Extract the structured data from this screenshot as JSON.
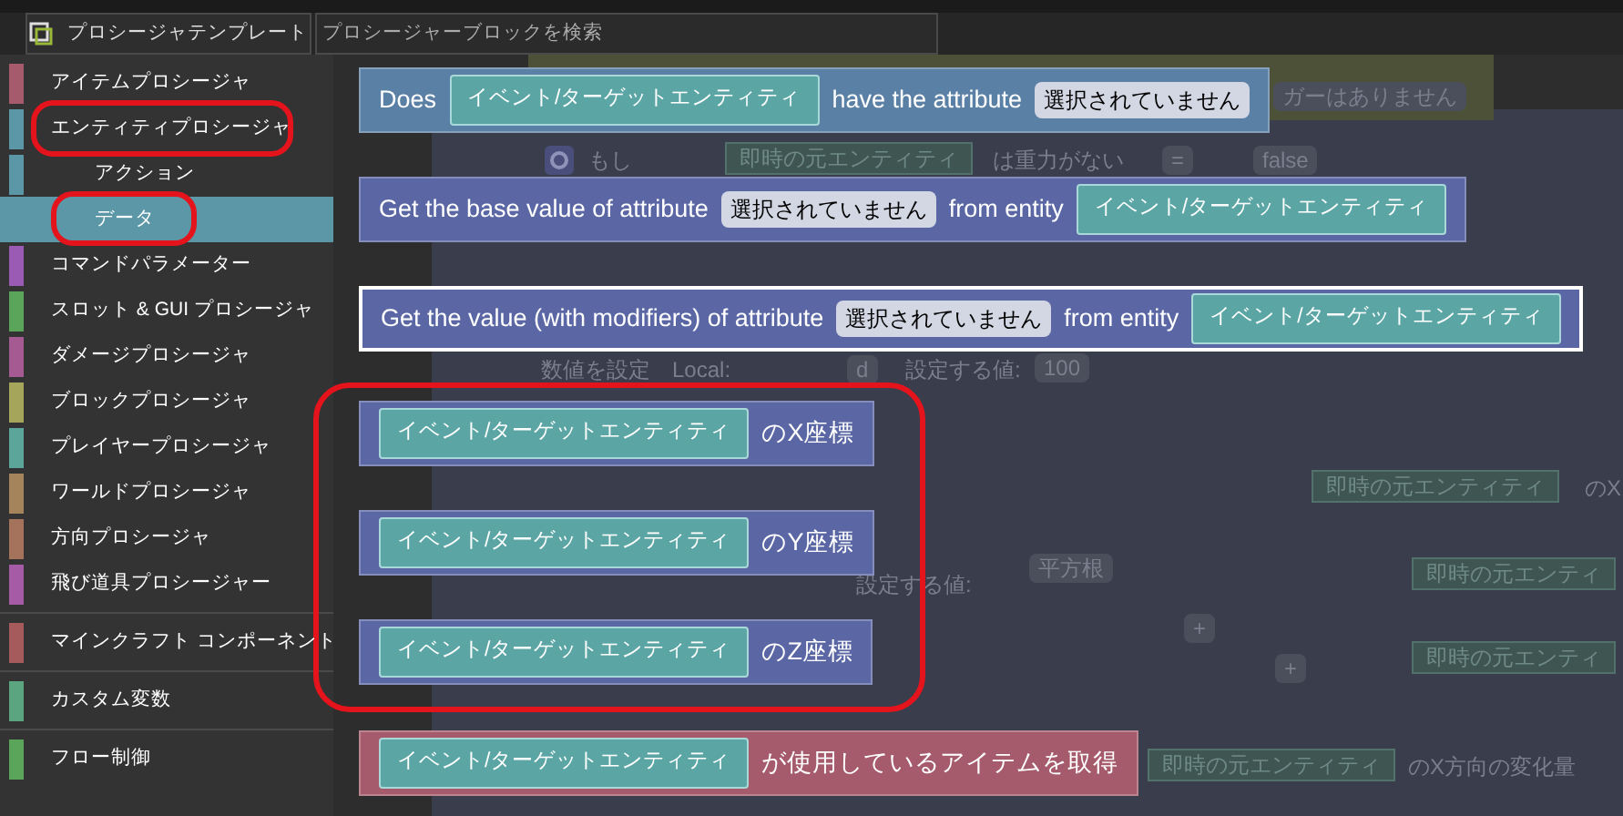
{
  "header": {
    "tab": "プロシージャテンプレート",
    "search": {
      "placeholder": "プロシージャーブロックを検索"
    }
  },
  "sidebar": {
    "groups": [
      [
        {
          "label": "アイテムプロシージャ",
          "kind": "category",
          "color": "#a55b6b",
          "selected": false,
          "circled": false
        },
        {
          "label": "エンティティプロシージャ",
          "kind": "category",
          "color": "#5b97a6",
          "selected": false,
          "circled": true
        },
        {
          "label": "アクション",
          "kind": "subcategory",
          "color": "#5b97a6",
          "selected": false,
          "circled": false
        },
        {
          "label": "データ",
          "kind": "subcategory",
          "color": "#5b97a6",
          "selected": true,
          "circled": true
        },
        {
          "label": "コマンドパラメーター",
          "kind": "category",
          "color": "#995bb3",
          "selected": false,
          "circled": false
        },
        {
          "label": "スロット & GUI プロシージャ",
          "kind": "category",
          "color": "#5ba55b",
          "selected": false,
          "circled": false
        },
        {
          "label": "ダメージプロシージャ",
          "kind": "category",
          "color": "#a55b91",
          "selected": false,
          "circled": false
        },
        {
          "label": "ブロックプロシージャ",
          "kind": "category",
          "color": "#a5a55b",
          "selected": false,
          "circled": false
        },
        {
          "label": "プレイヤープロシージャ",
          "kind": "category",
          "color": "#5ba59b",
          "selected": false,
          "circled": false
        },
        {
          "label": "ワールドプロシージャ",
          "kind": "category",
          "color": "#a5845b",
          "selected": false,
          "circled": false
        },
        {
          "label": "方向プロシージャ",
          "kind": "category",
          "color": "#a5725b",
          "selected": false,
          "circled": false
        },
        {
          "label": "飛び道具プロシージャー",
          "kind": "category",
          "color": "#a55ba5",
          "selected": false,
          "circled": false
        }
      ],
      [
        {
          "label": "マインクラフト コンポーネント",
          "kind": "category",
          "color": "#a55b5b",
          "selected": false,
          "circled": false
        }
      ],
      [
        {
          "label": "カスタム変数",
          "kind": "category",
          "color": "#5ba580",
          "selected": false,
          "circled": false
        }
      ],
      [
        {
          "label": "フロー制御",
          "kind": "category",
          "color": "#5ba55b",
          "selected": false,
          "circled": false
        }
      ]
    ]
  },
  "flyout": {
    "blocks": [
      {
        "color": "#5b80a5",
        "selected": false,
        "circled": false,
        "parts": [
          {
            "kind": "text",
            "text": "Does"
          },
          {
            "kind": "entity",
            "text": "イベント/ターゲットエンティティ"
          },
          {
            "kind": "text",
            "text": "have the attribute"
          },
          {
            "kind": "dropdown",
            "text": "選択されていません"
          }
        ]
      },
      {
        "color": "#5b67a5",
        "selected": false,
        "circled": false,
        "parts": [
          {
            "kind": "text",
            "text": "Get the base value of attribute"
          },
          {
            "kind": "dropdown",
            "text": "選択されていません"
          },
          {
            "kind": "text",
            "text": "from entity"
          },
          {
            "kind": "entity",
            "text": "イベント/ターゲットエンティティ"
          }
        ]
      },
      {
        "color": "#5b67a5",
        "selected": true,
        "circled": false,
        "parts": [
          {
            "kind": "text",
            "text": "Get the value (with modifiers) of attribute"
          },
          {
            "kind": "dropdown",
            "text": "選択されていません"
          },
          {
            "kind": "text",
            "text": "from entity"
          },
          {
            "kind": "entity",
            "text": "イベント/ターゲットエンティティ"
          }
        ]
      },
      {
        "color": "#5b67a5",
        "selected": false,
        "circled": true,
        "parts": [
          {
            "kind": "entity",
            "text": "イベント/ターゲットエンティティ"
          },
          {
            "kind": "text",
            "text": "のX座標"
          }
        ]
      },
      {
        "color": "#5b67a5",
        "selected": false,
        "circled": true,
        "parts": [
          {
            "kind": "entity",
            "text": "イベント/ターゲットエンティティ"
          },
          {
            "kind": "text",
            "text": "のY座標"
          }
        ]
      },
      {
        "color": "#5b67a5",
        "selected": false,
        "circled": true,
        "parts": [
          {
            "kind": "entity",
            "text": "イベント/ターゲットエンティティ"
          },
          {
            "kind": "text",
            "text": "のZ座標"
          }
        ]
      },
      {
        "color": "#a55b6b",
        "selected": false,
        "circled": false,
        "parts": [
          {
            "kind": "entity",
            "text": "イベント/ターゲットエンティティ"
          },
          {
            "kind": "text",
            "text": "が使用しているアイテムを取得"
          }
        ]
      }
    ]
  },
  "workspace": {
    "items": [
      {
        "kind": "chip",
        "text": "ガーはありません"
      },
      {
        "kind": "text",
        "text": "もし"
      },
      {
        "kind": "entity",
        "text": "即時の元エンティティ"
      },
      {
        "kind": "text",
        "text": "は重力がない"
      },
      {
        "kind": "chip",
        "text": "="
      },
      {
        "kind": "chip",
        "text": "false"
      },
      {
        "kind": "text",
        "text": "数値を設定"
      },
      {
        "kind": "text",
        "text": "Local:"
      },
      {
        "kind": "chip",
        "text": "d"
      },
      {
        "kind": "text",
        "text": "設定する値:"
      },
      {
        "kind": "chip",
        "text": "100"
      },
      {
        "kind": "entity",
        "text": "即時の元エンティティ"
      },
      {
        "kind": "text",
        "text": "のX"
      },
      {
        "kind": "text",
        "text": "設定する値:"
      },
      {
        "kind": "chip",
        "text": "平方根"
      },
      {
        "kind": "chip",
        "text": "+"
      },
      {
        "kind": "chip",
        "text": "+"
      },
      {
        "kind": "entity",
        "text": "即時の元エンティ"
      },
      {
        "kind": "entity",
        "text": "即時の元エンティ"
      },
      {
        "kind": "entity",
        "text": "即時の元エンティティ"
      },
      {
        "kind": "text",
        "text": "のX方向の変化量"
      }
    ]
  }
}
